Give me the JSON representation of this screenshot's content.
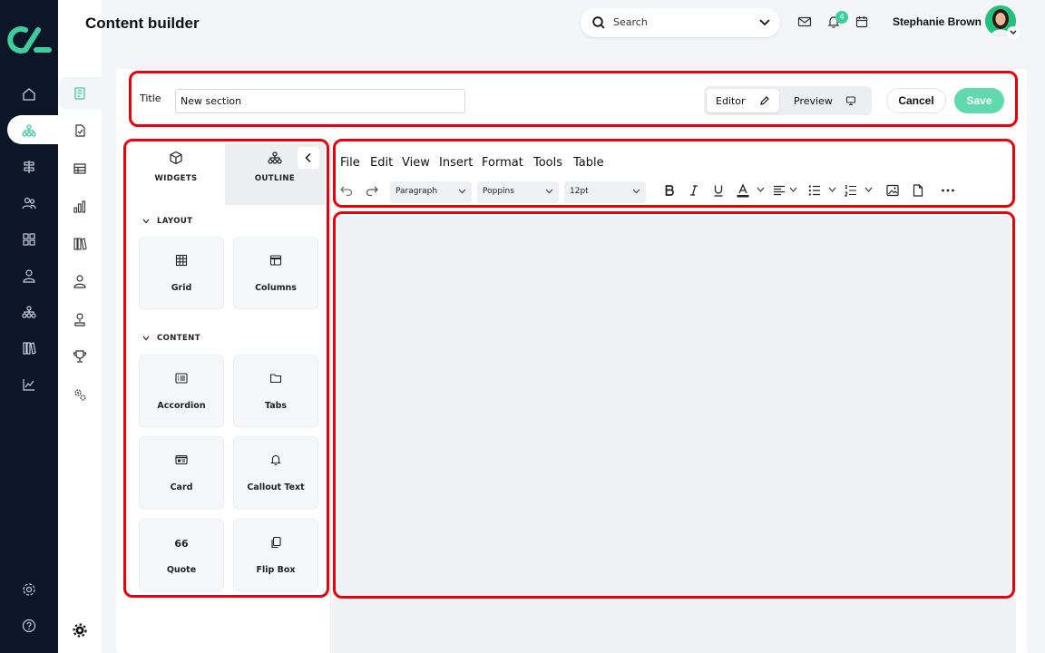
{
  "app": {
    "page_title": "Content builder"
  },
  "header": {
    "search_placeholder": "Search",
    "notifications_count": "4",
    "user_name": "Stephanie Brown"
  },
  "form": {
    "title_label": "Title",
    "title_value": "New section",
    "mode_editor": "Editor",
    "mode_preview": "Preview",
    "active_mode": "Editor",
    "cancel_label": "Cancel",
    "save_label": "Save"
  },
  "widgets_panel": {
    "tabs": [
      {
        "label": "WIDGETS"
      },
      {
        "label": "OUTLINE"
      }
    ],
    "active_tab": "WIDGETS",
    "sections": [
      {
        "label": "LAYOUT",
        "items": [
          {
            "label": "Grid",
            "icon": "grid-icon"
          },
          {
            "label": "Columns",
            "icon": "columns-icon"
          }
        ]
      },
      {
        "label": "CONTENT",
        "items": [
          {
            "label": "Accordion",
            "icon": "accordion-icon"
          },
          {
            "label": "Tabs",
            "icon": "folder-icon"
          },
          {
            "label": "Card",
            "icon": "card-icon"
          },
          {
            "label": "Callout Text",
            "icon": "bell-icon"
          },
          {
            "label": "Quote",
            "icon": "quote-icon",
            "glyph": "66"
          },
          {
            "label": "Flip Box",
            "icon": "copy-icon"
          }
        ]
      }
    ]
  },
  "editor": {
    "menu": [
      "File",
      "Edit",
      "View",
      "Insert",
      "Format",
      "Tools",
      "Table"
    ],
    "block_format": "Paragraph",
    "font_family": "Poppins",
    "font_size": "12pt"
  },
  "colors": {
    "accent": "#3ccf9c",
    "save_button": "#5fd9ad",
    "rail": "#0c1628",
    "highlight": "#e8000b"
  }
}
